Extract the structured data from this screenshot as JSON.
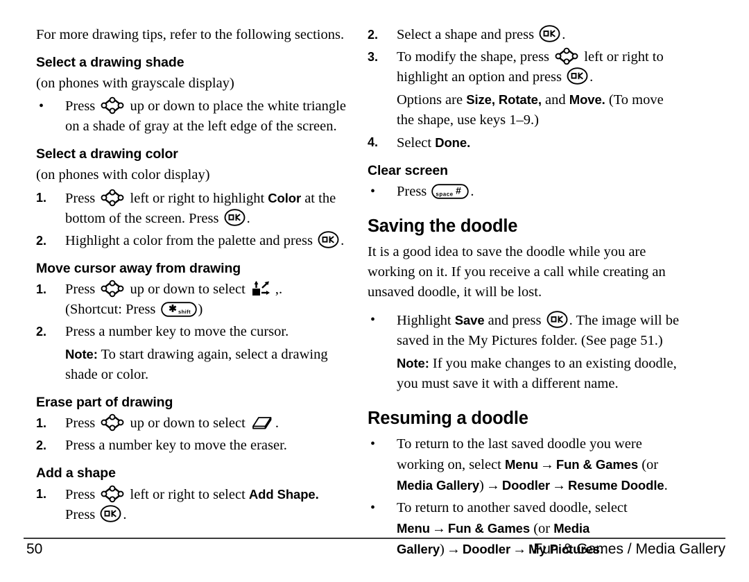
{
  "page": {
    "number": "50",
    "footer_right": "Fun & Games / Media Gallery"
  },
  "icons": {
    "nav": "navigation-key-icon",
    "ok": "ok-key-icon",
    "shift": "star-shift-key-icon",
    "space": "space-pound-key-icon",
    "cursor": "move-cursor-icon",
    "eraser": "eraser-icon"
  },
  "left_column": {
    "intro": "For more drawing tips, refer to the following sections.",
    "shade_section": {
      "heading": "Select a drawing shade",
      "subtitle": "(on phones with grayscale display)",
      "bullet": {
        "before": "Press",
        "after": "up or down to place the white triangle on a shade of gray at the left edge of the screen."
      }
    },
    "color_section": {
      "heading": "Select a drawing color",
      "subtitle": "(on phones with color display)",
      "step1": {
        "marker": "1.",
        "part1": "Press",
        "part2": "left or right to highlight",
        "bold1": "Color",
        "part3": "at the bottom of the screen. Press",
        "part4": "."
      },
      "step2": {
        "marker": "2.",
        "part1": "Highlight a color from the palette and press",
        "part2": "."
      }
    },
    "move_cursor_section": {
      "heading": "Move cursor away from drawing",
      "step1": {
        "marker": "1.",
        "part1": "Press",
        "part2": "up or down to select",
        "part3": ",.",
        "shortcut_before": "(Shortcut: Press",
        "shortcut_after": ")"
      },
      "step2": {
        "marker": "2.",
        "text": "Press a number key to move the cursor."
      },
      "note": {
        "label": "Note:",
        "text": "To start drawing again, select a drawing shade or color."
      }
    },
    "erase_section": {
      "heading": "Erase part of drawing",
      "step1": {
        "marker": "1.",
        "part1": "Press",
        "part2": "up or down to select",
        "part3": "."
      },
      "step2": {
        "marker": "2.",
        "text": "Press a number key to move the eraser."
      }
    },
    "add_shape_section": {
      "heading": "Add a shape",
      "step1": {
        "marker": "1.",
        "part1": "Press",
        "part2": "left or right to select",
        "bold1": "Add Shape.",
        "part3": "Press",
        "part4": "."
      }
    }
  },
  "right_column": {
    "add_shape_continued": {
      "step2": {
        "marker": "2.",
        "part1": "Select a shape and press",
        "part2": "."
      },
      "step3": {
        "marker": "3.",
        "part1": "To modify the shape, press",
        "part2": "left or right to highlight an option and press",
        "part3": "."
      },
      "options": {
        "part1": "Options are",
        "bold1": "Size, Rotate,",
        "part2": "and",
        "bold2": "Move.",
        "part3": "(To move the shape, use keys 1–9.)"
      },
      "step4": {
        "marker": "4.",
        "part1": "Select",
        "bold1": "Done."
      }
    },
    "clear_screen_section": {
      "heading": "Clear screen",
      "bullet": {
        "before": "Press",
        "after": "."
      }
    },
    "saving_section": {
      "heading": "Saving the doodle",
      "paragraph": "It is a good idea to save the doodle while you are working on it. If you receive a call while creating an unsaved doodle, it will be lost.",
      "bullet": {
        "part1": "Highlight",
        "bold1": "Save",
        "part2": "and press",
        "part3": ". The image will be saved in the My Pictures folder. (See page 51.)"
      },
      "note": {
        "label": "Note:",
        "text": "If you make changes to an existing doodle, you must save it with a different name."
      }
    },
    "resuming_section": {
      "heading": "Resuming a doodle",
      "bullet1": {
        "part1": "To return to the last saved doodle you were working on, select",
        "bold1": "Menu",
        "arrow1": "→",
        "bold2": "Fun & Games",
        "part2": "(or",
        "bold3": "Media Gallery",
        "part3": ")",
        "arrow2": "→",
        "bold4": "Doodler",
        "arrow3": "→",
        "bold5": "Resume Doodle",
        "part4": "."
      },
      "bullet2": {
        "part1": "To return to another saved doodle, select",
        "bold1": "Menu",
        "arrow1": "→",
        "bold2": "Fun & Games",
        "part2": "(or",
        "bold3": "Media Gallery",
        "part3": ")",
        "arrow2": "→",
        "bold4": "Doodler",
        "arrow3": "→",
        "bold5": "My Pictures",
        "part4": "."
      }
    }
  }
}
